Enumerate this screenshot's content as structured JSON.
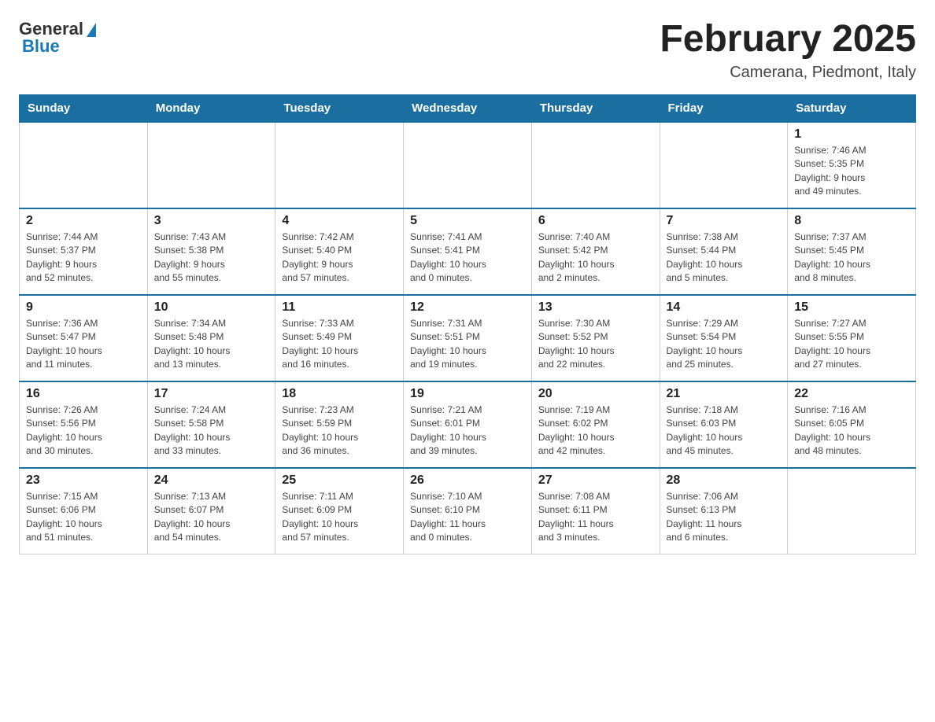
{
  "header": {
    "logo_general": "General",
    "logo_blue": "Blue",
    "month_title": "February 2025",
    "location": "Camerana, Piedmont, Italy"
  },
  "days_of_week": [
    "Sunday",
    "Monday",
    "Tuesday",
    "Wednesday",
    "Thursday",
    "Friday",
    "Saturday"
  ],
  "weeks": [
    [
      {
        "day": "",
        "info": ""
      },
      {
        "day": "",
        "info": ""
      },
      {
        "day": "",
        "info": ""
      },
      {
        "day": "",
        "info": ""
      },
      {
        "day": "",
        "info": ""
      },
      {
        "day": "",
        "info": ""
      },
      {
        "day": "1",
        "info": "Sunrise: 7:46 AM\nSunset: 5:35 PM\nDaylight: 9 hours\nand 49 minutes."
      }
    ],
    [
      {
        "day": "2",
        "info": "Sunrise: 7:44 AM\nSunset: 5:37 PM\nDaylight: 9 hours\nand 52 minutes."
      },
      {
        "day": "3",
        "info": "Sunrise: 7:43 AM\nSunset: 5:38 PM\nDaylight: 9 hours\nand 55 minutes."
      },
      {
        "day": "4",
        "info": "Sunrise: 7:42 AM\nSunset: 5:40 PM\nDaylight: 9 hours\nand 57 minutes."
      },
      {
        "day": "5",
        "info": "Sunrise: 7:41 AM\nSunset: 5:41 PM\nDaylight: 10 hours\nand 0 minutes."
      },
      {
        "day": "6",
        "info": "Sunrise: 7:40 AM\nSunset: 5:42 PM\nDaylight: 10 hours\nand 2 minutes."
      },
      {
        "day": "7",
        "info": "Sunrise: 7:38 AM\nSunset: 5:44 PM\nDaylight: 10 hours\nand 5 minutes."
      },
      {
        "day": "8",
        "info": "Sunrise: 7:37 AM\nSunset: 5:45 PM\nDaylight: 10 hours\nand 8 minutes."
      }
    ],
    [
      {
        "day": "9",
        "info": "Sunrise: 7:36 AM\nSunset: 5:47 PM\nDaylight: 10 hours\nand 11 minutes."
      },
      {
        "day": "10",
        "info": "Sunrise: 7:34 AM\nSunset: 5:48 PM\nDaylight: 10 hours\nand 13 minutes."
      },
      {
        "day": "11",
        "info": "Sunrise: 7:33 AM\nSunset: 5:49 PM\nDaylight: 10 hours\nand 16 minutes."
      },
      {
        "day": "12",
        "info": "Sunrise: 7:31 AM\nSunset: 5:51 PM\nDaylight: 10 hours\nand 19 minutes."
      },
      {
        "day": "13",
        "info": "Sunrise: 7:30 AM\nSunset: 5:52 PM\nDaylight: 10 hours\nand 22 minutes."
      },
      {
        "day": "14",
        "info": "Sunrise: 7:29 AM\nSunset: 5:54 PM\nDaylight: 10 hours\nand 25 minutes."
      },
      {
        "day": "15",
        "info": "Sunrise: 7:27 AM\nSunset: 5:55 PM\nDaylight: 10 hours\nand 27 minutes."
      }
    ],
    [
      {
        "day": "16",
        "info": "Sunrise: 7:26 AM\nSunset: 5:56 PM\nDaylight: 10 hours\nand 30 minutes."
      },
      {
        "day": "17",
        "info": "Sunrise: 7:24 AM\nSunset: 5:58 PM\nDaylight: 10 hours\nand 33 minutes."
      },
      {
        "day": "18",
        "info": "Sunrise: 7:23 AM\nSunset: 5:59 PM\nDaylight: 10 hours\nand 36 minutes."
      },
      {
        "day": "19",
        "info": "Sunrise: 7:21 AM\nSunset: 6:01 PM\nDaylight: 10 hours\nand 39 minutes."
      },
      {
        "day": "20",
        "info": "Sunrise: 7:19 AM\nSunset: 6:02 PM\nDaylight: 10 hours\nand 42 minutes."
      },
      {
        "day": "21",
        "info": "Sunrise: 7:18 AM\nSunset: 6:03 PM\nDaylight: 10 hours\nand 45 minutes."
      },
      {
        "day": "22",
        "info": "Sunrise: 7:16 AM\nSunset: 6:05 PM\nDaylight: 10 hours\nand 48 minutes."
      }
    ],
    [
      {
        "day": "23",
        "info": "Sunrise: 7:15 AM\nSunset: 6:06 PM\nDaylight: 10 hours\nand 51 minutes."
      },
      {
        "day": "24",
        "info": "Sunrise: 7:13 AM\nSunset: 6:07 PM\nDaylight: 10 hours\nand 54 minutes."
      },
      {
        "day": "25",
        "info": "Sunrise: 7:11 AM\nSunset: 6:09 PM\nDaylight: 10 hours\nand 57 minutes."
      },
      {
        "day": "26",
        "info": "Sunrise: 7:10 AM\nSunset: 6:10 PM\nDaylight: 11 hours\nand 0 minutes."
      },
      {
        "day": "27",
        "info": "Sunrise: 7:08 AM\nSunset: 6:11 PM\nDaylight: 11 hours\nand 3 minutes."
      },
      {
        "day": "28",
        "info": "Sunrise: 7:06 AM\nSunset: 6:13 PM\nDaylight: 11 hours\nand 6 minutes."
      },
      {
        "day": "",
        "info": ""
      }
    ]
  ]
}
